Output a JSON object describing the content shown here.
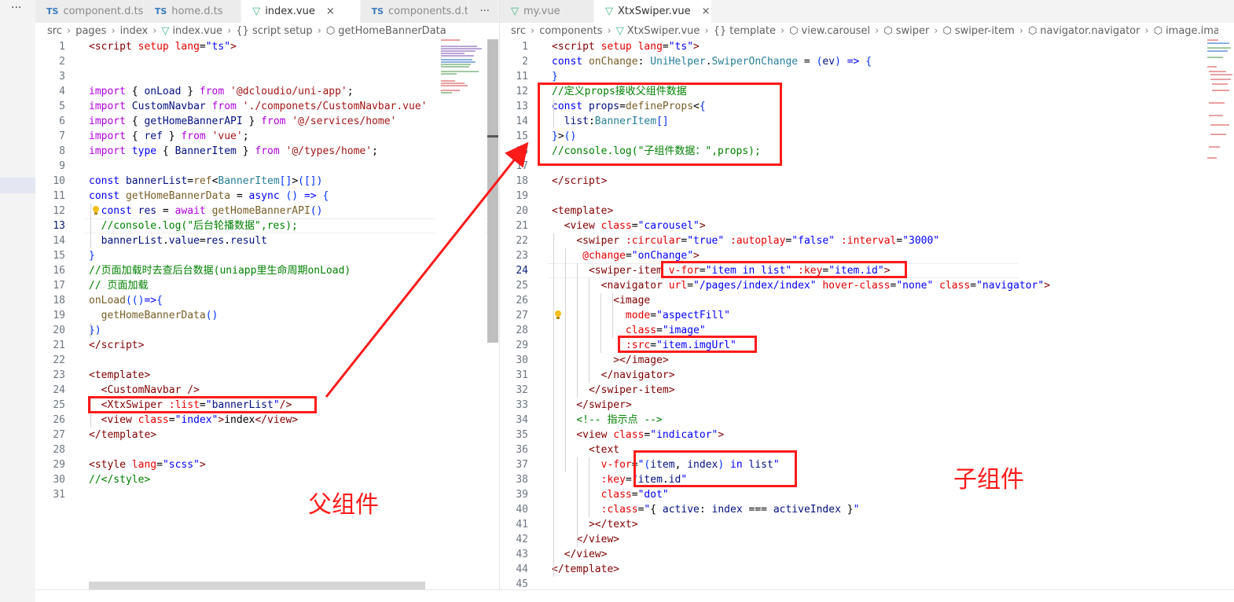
{
  "left_pane": {
    "tabs": [
      {
        "kind": "TS",
        "label": "component.d.ts",
        "active": false
      },
      {
        "kind": "TS",
        "label": "home.d.ts",
        "active": false
      },
      {
        "kind": "vue",
        "label": "index.vue",
        "active": true,
        "close": "×"
      },
      {
        "kind": "TS",
        "label": "components.d.ts",
        "active": false
      }
    ],
    "more": "···",
    "breadcrumb": [
      "src",
      "pages",
      "index",
      "index.vue",
      "{} script setup",
      "getHomeBannerData"
    ],
    "lines": [
      {
        "n": "1",
        "h": "<span class='t'>&lt;script</span> <span class='a'>setup</span> <span class='a'>lang</span>=<span class='b'>\"ts\"</span><span class='t'>&gt;</span>"
      },
      {
        "n": "2",
        "h": ""
      },
      {
        "n": "3",
        "h": ""
      },
      {
        "n": "4",
        "h": "<span class='k'>import</span> { <span class='v'>onLoad</span> } <span class='k'>from</span> <span class='s'>'@dcloudio/uni-app'</span>;"
      },
      {
        "n": "5",
        "h": "<span class='k'>import</span> <span class='v'>CustomNavbar</span> <span class='k'>from</span> <span class='s'>'./componets/CustomNavbar.vue'</span>"
      },
      {
        "n": "6",
        "h": "<span class='k'>import</span> { <span class='v'>getHomeBannerAPI</span> } <span class='k'>from</span> <span class='s'>'@/services/home'</span>"
      },
      {
        "n": "7",
        "h": "<span class='k'>import</span> { <span class='v'>ref</span> } <span class='k'>from</span> <span class='s'>'vue'</span>;"
      },
      {
        "n": "8",
        "h": "<span class='k'>import</span> <span class='b'>type</span> { <span class='v'>BannerItem</span> } <span class='k'>from</span> <span class='s'>'@/types/home'</span>;"
      },
      {
        "n": "9",
        "h": ""
      },
      {
        "n": "10",
        "h": "<span class='b'>const</span> <span class='v'>bannerList</span>=<span class='f'>ref</span>&lt;<span class='ty'>BannerItem</span><span class='p'>[]</span>&gt;<span class='p'>(</span><span class='p'>[]</span><span class='p'>)</span>"
      },
      {
        "n": "11",
        "h": "<span class='b'>const</span> <span class='f'>getHomeBannerData</span> = <span class='b'>async</span> <span class='p'>()</span> <span class='b'>=&gt;</span> <span class='p'>{</span>"
      },
      {
        "n": "12",
        "h": "  <span class='b'>const</span> <span class='v'>res</span> = <span class='k'>await</span> <span class='f'>getHomeBannerAPI</span><span class='p'>()</span>"
      },
      {
        "n": "13",
        "h": "  <span class='c'>//console.log(\"后台轮播数据\",res);</span>"
      },
      {
        "n": "14",
        "h": "  <span class='v'>bannerList</span>.<span class='v'>value</span>=<span class='v'>res</span>.<span class='v'>result</span>"
      },
      {
        "n": "15",
        "h": "<span class='p'>}</span>"
      },
      {
        "n": "16",
        "h": "<span class='c'>//页面加载时去查后台数据(uniapp里生命周期onLoad)</span>"
      },
      {
        "n": "17",
        "h": "<span class='c'>// 页面加载</span>"
      },
      {
        "n": "18",
        "h": "<span class='f'>onLoad</span><span class='p'>(()</span><span class='b'>=&gt;</span><span class='p'>{</span>"
      },
      {
        "n": "19",
        "h": "  <span class='f'>getHomeBannerData</span><span class='p'>()</span>"
      },
      {
        "n": "20",
        "h": "<span class='p'>})</span>"
      },
      {
        "n": "21",
        "h": "<span class='t'>&lt;/script&gt;</span>"
      },
      {
        "n": "22",
        "h": ""
      },
      {
        "n": "23",
        "h": "<span class='t'>&lt;template&gt;</span>"
      },
      {
        "n": "24",
        "h": "  <span class='t'>&lt;CustomNavbar</span> <span class='t'>/&gt;</span>"
      },
      {
        "n": "25",
        "h": "  <span class='t'>&lt;XtxSwiper</span> <span class='a'>:list</span>=<span class='b'>\"</span><span class='v'>bannerList</span><span class='b'>\"</span><span class='t'>/&gt;</span>"
      },
      {
        "n": "26",
        "h": "  <span class='t'>&lt;view</span> <span class='a'>class</span>=<span class='b'>\"index\"</span><span class='t'>&gt;</span>index<span class='t'>&lt;/view&gt;</span>"
      },
      {
        "n": "27",
        "h": "<span class='t'>&lt;/template&gt;</span>"
      },
      {
        "n": "28",
        "h": ""
      },
      {
        "n": "29",
        "h": "<span class='t'>&lt;style</span> <span class='a'>lang</span>=<span class='b'>\"scss\"</span><span class='t'>&gt;</span>"
      },
      {
        "n": "30",
        "h": "<span class='c'>//&lt;/style&gt;</span>"
      },
      {
        "n": "31",
        "h": ""
      }
    ],
    "annotation": "父组件"
  },
  "right_pane": {
    "tabs": [
      {
        "kind": "vue",
        "label": "my.vue",
        "active": false
      },
      {
        "kind": "vue",
        "label": "XtxSwiper.vue",
        "active": true,
        "close": "×"
      }
    ],
    "breadcrumb": [
      "src",
      "components",
      "XtxSwiper.vue",
      "{} template",
      "view.carousel",
      "swiper",
      "swiper-item",
      "navigator.navigator",
      "image.image"
    ],
    "lines": [
      {
        "n": "1",
        "h": "<span class='t'>&lt;script</span> <span class='a'>setup</span> <span class='a'>lang</span>=<span class='b'>\"ts\"</span><span class='t'>&gt;</span>"
      },
      {
        "n": "2",
        "h": "<span class='b'>const</span> <span class='f'>onChange</span>: <span class='ty'>UniHelper</span>.<span class='ty'>SwiperOnChange</span> = <span class='p'>(</span><span class='v'>ev</span><span class='p'>)</span> <span class='b'>=&gt;</span> <span class='p'>{</span>"
      },
      {
        "n": "11",
        "h": "<span class='p'>}</span>"
      },
      {
        "n": "12",
        "h": "<span class='c'>//定义props接收父组件数据</span>"
      },
      {
        "n": "13",
        "h": "<span class='b'>const</span> <span class='v'>props</span>=<span class='f'>defineProps</span>&lt;<span class='p'>{</span>"
      },
      {
        "n": "14",
        "h": "  <span class='v'>list</span>:<span class='ty'>BannerItem</span><span class='p'>[]</span>"
      },
      {
        "n": "15",
        "h": "<span class='p'>}</span>&gt;<span class='p'>()</span>"
      },
      {
        "n": "16",
        "h": "<span class='c'>//console.log(\"子组件数据：\",props);</span>"
      },
      {
        "n": "17",
        "h": ""
      },
      {
        "n": "18",
        "h": "<span class='t'>&lt;/script&gt;</span>"
      },
      {
        "n": "19",
        "h": ""
      },
      {
        "n": "20",
        "h": "<span class='t'>&lt;template&gt;</span>"
      },
      {
        "n": "21",
        "h": "  <span class='t'>&lt;view</span> <span class='a'>class</span>=<span class='b'>\"carousel\"</span><span class='t'>&gt;</span>"
      },
      {
        "n": "22",
        "h": "    <span class='t'>&lt;swiper</span> <span class='a'>:circular</span>=<span class='b'>\"true\"</span> <span class='a'>:autoplay</span>=<span class='b'>\"false\"</span> <span class='a'>:interval</span>=<span class='b'>\"3000\"</span>"
      },
      {
        "n": "23",
        "h": "     <span class='a'>@change</span>=<span class='b'>\"onChange\"</span><span class='t'>&gt;</span>"
      },
      {
        "n": "24",
        "h": "      <span class='t'>&lt;swiper-item</span> <span class='a'>v-for</span>=<span class='b'>\"item in list\"</span> <span class='a'>:key</span>=<span class='b'>\"item.id\"</span><span class='t'>&gt;</span>"
      },
      {
        "n": "25",
        "h": "        <span class='t'>&lt;navigator</span> <span class='a'>url</span>=<span class='b'>\"/pages/index/index\"</span> <span class='a'>hover-class</span>=<span class='b'>\"none\"</span> <span class='a'>class</span>=<span class='b'>\"navigator\"</span><span class='t'>&gt;</span>"
      },
      {
        "n": "26",
        "h": "          <span class='t'>&lt;image</span>"
      },
      {
        "n": "27",
        "h": "            <span class='a'>mode</span>=<span class='b'>\"aspectFill\"</span>"
      },
      {
        "n": "28",
        "h": "            <span class='a'>class</span>=<span class='b'>\"image\"</span>"
      },
      {
        "n": "29",
        "h": "            <span class='a'>:src</span>=<span class='b'>\"item.imgUrl\"</span>"
      },
      {
        "n": "30",
        "h": "          <span class='t'>&gt;&lt;/image&gt;</span>"
      },
      {
        "n": "31",
        "h": "        <span class='t'>&lt;/navigator&gt;</span>"
      },
      {
        "n": "32",
        "h": "      <span class='t'>&lt;/swiper-item&gt;</span>"
      },
      {
        "n": "33",
        "h": "    <span class='t'>&lt;/swiper&gt;</span>"
      },
      {
        "n": "34",
        "h": "    <span class='c'>&lt;!-- 指示点 --&gt;</span>"
      },
      {
        "n": "35",
        "h": "    <span class='t'>&lt;view</span> <span class='a'>class</span>=<span class='b'>\"indicator\"</span><span class='t'>&gt;</span>"
      },
      {
        "n": "36",
        "h": "      <span class='t'>&lt;text</span>"
      },
      {
        "n": "37",
        "h": "        <span class='a'>v-for</span>=<span class='b'>\"</span><span class='p'>(</span><span class='v'>item</span>, <span class='v'>index</span><span class='p'>)</span> <span class='b'>in</span> <span class='v'>list</span><span class='b'>\"</span>"
      },
      {
        "n": "38",
        "h": "        <span class='a'>:key</span>=<span class='b'>\"</span><span class='v'>item</span>.<span class='v'>id</span><span class='b'>\"</span>"
      },
      {
        "n": "39",
        "h": "        <span class='a'>class</span>=<span class='b'>\"dot\"</span>"
      },
      {
        "n": "40",
        "h": "        <span class='a'>:class</span>=<span class='b'>\"</span>{ <span class='v'>active</span>: <span class='v'>index</span> === <span class='v'>activeIndex</span> }<span class='b'>\"</span>"
      },
      {
        "n": "41",
        "h": "      <span class='t'>&gt;&lt;/text&gt;</span>"
      },
      {
        "n": "42",
        "h": "    <span class='t'>&lt;/view&gt;</span>"
      },
      {
        "n": "43",
        "h": "  <span class='t'>&lt;/view&gt;</span>"
      },
      {
        "n": "44",
        "h": "<span class='t'>&lt;/template&gt;</span>"
      },
      {
        "n": "45",
        "h": ""
      }
    ],
    "annotation": "子组件"
  },
  "colors": {
    "annotation": "#ff1a1a",
    "vue_icon": "#41b883",
    "ts_icon": "#3a7bbf"
  }
}
